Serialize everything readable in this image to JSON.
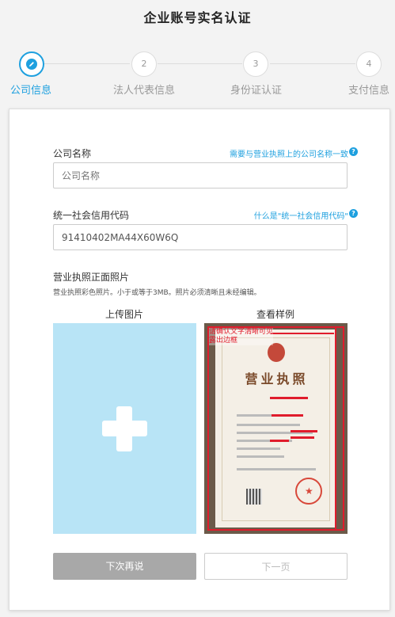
{
  "page": {
    "title": "企业账号实名认证"
  },
  "steps": [
    {
      "num": "",
      "label": "公司信息",
      "active": true,
      "icon": "pencil-icon"
    },
    {
      "num": "2",
      "label": "法人代表信息",
      "active": false
    },
    {
      "num": "3",
      "label": "身份证认证",
      "active": false
    },
    {
      "num": "4",
      "label": "支付信息",
      "active": false
    }
  ],
  "form": {
    "company_name": {
      "label": "公司名称",
      "help": "需要与营业执照上的公司名称一致",
      "placeholder": "公司名称",
      "value": ""
    },
    "credit_code": {
      "label": "统一社会信用代码",
      "help": "什么是\"统一社会信用代码\"",
      "placeholder": "",
      "value": "91410402MA44X60W6Q"
    },
    "license": {
      "title": "营业执照正面照片",
      "desc": "营业执照彩色照片。小于或等于3MB。照片必须清晰且未经编辑。",
      "upload_label": "上传图片",
      "sample_label": "查看样例",
      "sample_note_1": "请确认文字清晰可见",
      "sample_note_2": "露出边框",
      "sample_doc_title": "营业执照"
    }
  },
  "buttons": {
    "later": "下次再说",
    "next": "下一页"
  },
  "colors": {
    "accent": "#1ea0df",
    "upload_bg": "#b8e4f6",
    "highlight_red": "#e01c2c"
  }
}
